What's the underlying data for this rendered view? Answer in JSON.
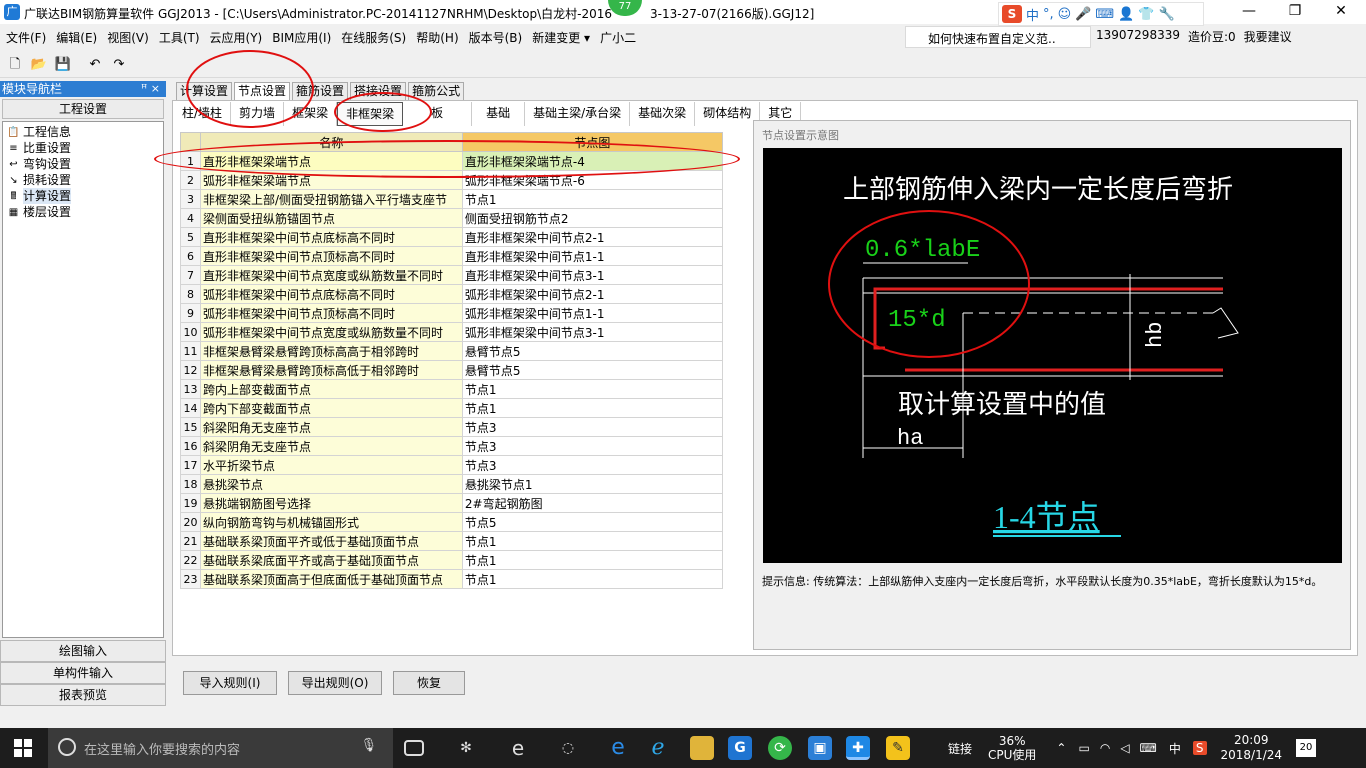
{
  "window": {
    "app_icon": "广",
    "title": "广联达BIM钢筋算量软件 GGJ2013 - [C:\\Users\\Administrator.PC-20141127NRHM\\Desktop\\白龙村-2016",
    "title_tail": "3-13-27-07(2166版).GGJ12]",
    "badge": "77",
    "ime": {
      "logo": "S",
      "mode": "中",
      "punct": "°,",
      "icons": [
        "☺",
        "🎤",
        "⌨",
        "👤",
        "👕",
        "🔧"
      ]
    },
    "controls": {
      "minimize": "—",
      "maximize": "❐",
      "close": "✕"
    }
  },
  "menu": {
    "items": [
      "文件(F)",
      "编辑(E)",
      "视图(V)",
      "工具(T)",
      "云应用(Y)",
      "BIM应用(I)",
      "在线服务(S)",
      "帮助(H)",
      "版本号(B)",
      "新建变更 ▾",
      "广小二"
    ],
    "help_text": "如何快速布置自定义范..",
    "phone": "13907298339",
    "cost_beans": "造价豆:0",
    "suggest": "我要建议"
  },
  "toolbar": {
    "icons": [
      "new-file-icon",
      "open-folder-icon",
      "save-icon",
      "undo-icon",
      "redo-icon"
    ],
    "glyphs": [
      "🗋",
      "📂",
      "💾",
      "↶",
      "↷"
    ]
  },
  "nav": {
    "header": "模块导航栏",
    "pin": "ꟸ ×",
    "section": "工程设置",
    "items": [
      {
        "label": "工程信息",
        "icon": "📋"
      },
      {
        "label": "比重设置",
        "icon": "≡"
      },
      {
        "label": "弯钩设置",
        "icon": "↩"
      },
      {
        "label": "损耗设置",
        "icon": "↘"
      },
      {
        "label": "计算设置",
        "icon": "🖩"
      },
      {
        "label": "楼层设置",
        "icon": "▦"
      }
    ],
    "bottom": [
      "绘图输入",
      "单构件输入",
      "报表预览"
    ]
  },
  "main_tabs": [
    "计算设置",
    "节点设置",
    "箍筋设置",
    "搭接设置",
    "箍筋公式"
  ],
  "sub_tabs": [
    "柱/墙柱",
    "剪力墙",
    "框架梁",
    "非框架梁",
    "板",
    "基础",
    "基础主梁/承台梁",
    "基础次梁",
    "砌体结构",
    "其它"
  ],
  "table": {
    "headers": [
      "",
      "名称",
      "节点图"
    ],
    "rows": [
      [
        "1",
        "直形非框架梁端节点",
        "直形非框架梁端节点-4"
      ],
      [
        "2",
        "弧形非框架梁端节点",
        "弧形非框架梁端节点-6"
      ],
      [
        "3",
        "非框架梁上部/侧面受扭钢筋锚入平行墙支座节",
        "节点1"
      ],
      [
        "4",
        "梁侧面受扭纵筋锚固节点",
        "侧面受扭钢筋节点2"
      ],
      [
        "5",
        "直形非框架梁中间节点底标高不同时",
        "直形非框架梁中间节点2-1"
      ],
      [
        "6",
        "直形非框架梁中间节点顶标高不同时",
        "直形非框架梁中间节点1-1"
      ],
      [
        "7",
        "直形非框架梁中间节点宽度或纵筋数量不同时",
        "直形非框架梁中间节点3-1"
      ],
      [
        "8",
        "弧形非框架梁中间节点底标高不同时",
        "弧形非框架梁中间节点2-1"
      ],
      [
        "9",
        "弧形非框架梁中间节点顶标高不同时",
        "弧形非框架梁中间节点1-1"
      ],
      [
        "10",
        "弧形非框架梁中间节点宽度或纵筋数量不同时",
        "弧形非框架梁中间节点3-1"
      ],
      [
        "11",
        "非框架悬臂梁悬臂跨顶标高高于相邻跨时",
        "悬臂节点5"
      ],
      [
        "12",
        "非框架悬臂梁悬臂跨顶标高低于相邻跨时",
        "悬臂节点5"
      ],
      [
        "13",
        "跨内上部变截面节点",
        "节点1"
      ],
      [
        "14",
        "跨内下部变截面节点",
        "节点1"
      ],
      [
        "15",
        "斜梁阳角无支座节点",
        "节点3"
      ],
      [
        "16",
        "斜梁阴角无支座节点",
        "节点3"
      ],
      [
        "17",
        "水平折梁节点",
        "节点3"
      ],
      [
        "18",
        "悬挑梁节点",
        "悬挑梁节点1"
      ],
      [
        "19",
        "悬挑端钢筋图号选择",
        "2#弯起钢筋图"
      ],
      [
        "20",
        "纵向钢筋弯钩与机械锚固形式",
        "节点5"
      ],
      [
        "21",
        "基础联系梁顶面平齐或低于基础顶面节点",
        "节点1"
      ],
      [
        "22",
        "基础联系梁底面平齐或高于基础顶面节点",
        "节点1"
      ],
      [
        "23",
        "基础联系梁顶面高于但底面低于基础顶面节点",
        "节点1"
      ]
    ]
  },
  "diagram": {
    "caption": "节点设置示意图",
    "title": "上部钢筋伸入梁内一定长度后弯折",
    "label_labe": "0.6*labE",
    "label_15d": "15*d",
    "label_hb": "hb",
    "label_note": "取计算设置中的值",
    "label_ha": "ha",
    "node_name": "1-4节点",
    "hint": "提示信息:  传统算法：上部纵筋伸入支座内一定长度后弯折，水平段默认长度为0.35*labE，弯折长度默认为15*d。"
  },
  "buttons": {
    "import": "导入规则(I)",
    "export": "导出规则(O)",
    "restore": "恢复"
  },
  "taskbar": {
    "search_placeholder": "在这里输入你要搜索的内容",
    "icons": [
      "task-view-icon",
      "fan-icon",
      "edge-icon",
      "browser-icon",
      "edge-new-icon",
      "ie-icon",
      "folder-icon",
      "glodon-icon",
      "360-icon",
      "store-icon",
      "glodon-ggj-icon",
      "notes-icon"
    ],
    "tray": {
      "link": "链接",
      "cpu_pct": "36%",
      "cpu_label": "CPU使用",
      "ime": "中",
      "time": "20:09",
      "date": "2018/1/24",
      "notif": "20"
    }
  },
  "colors": {
    "accent": "#2d7dd2",
    "annotation": "#e01010",
    "diagram_bg": "#000000",
    "rebar": "#e02020",
    "dim_green": "#19d219",
    "node_cyan": "#27d7e6"
  }
}
